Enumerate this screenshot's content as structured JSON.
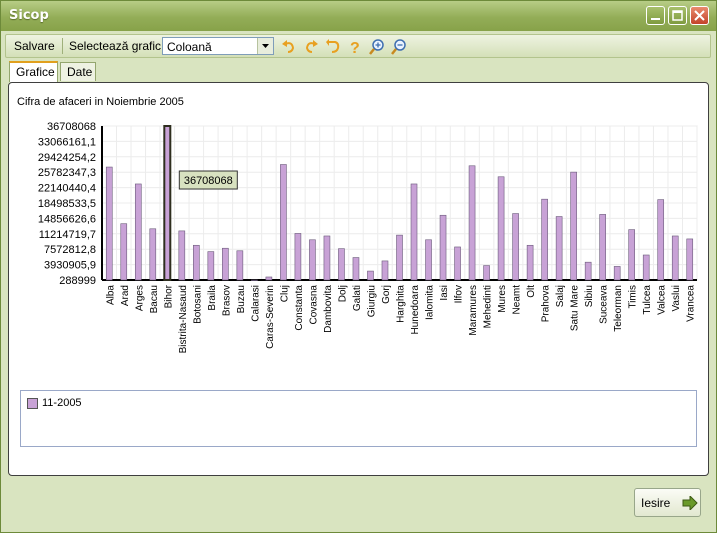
{
  "window": {
    "title": "Sicop"
  },
  "toolbar": {
    "save_label": "Salvare",
    "select_chart_label": "Selectează grafic",
    "chart_type_value": "Coloană",
    "icons": [
      "undo-icon",
      "redo-icon",
      "refresh-icon",
      "help-icon",
      "zoom-in-icon",
      "zoom-out-icon"
    ]
  },
  "tabs": [
    {
      "label": "Grafice",
      "active": true
    },
    {
      "label": "Date",
      "active": false
    }
  ],
  "tooltip": {
    "text": "36708068"
  },
  "legend": {
    "label": "11-2005"
  },
  "exit_label": "Iesire",
  "colors": {
    "bar": "#c8a2d6",
    "bar_border": "#6a5a7a",
    "highlight": "#2e2e1e",
    "tooltip_bg": "#d8e2c0",
    "window": "#d9e4c0",
    "title_bar": "#93ad57"
  },
  "chart_data": {
    "type": "bar",
    "title": "Cifra de afaceri in Noiembrie 2005",
    "ylim": [
      288999,
      36708068
    ],
    "yticks": [
      "36708068",
      "33066161,1",
      "29424254,2",
      "25782347,3",
      "22140440,4",
      "18498533,5",
      "14856626,6",
      "11214719,7",
      "7572812,8",
      "3930905,9",
      "288999"
    ],
    "grid": true,
    "legend_placement": "bottom",
    "highlighted_category": "Bihor",
    "categories": [
      "Alba",
      "Arad",
      "Arges",
      "Bacau",
      "Bihor",
      "Bistrita-Nasaud",
      "Botosani",
      "Braila",
      "Brasov",
      "Buzau",
      "Calarasi",
      "Caras-Severin",
      "Cluj",
      "Constanta",
      "Covasna",
      "Dambovita",
      "Dolj",
      "Galati",
      "Giurgiu",
      "Gorj",
      "Harghita",
      "Hunedoara",
      "Ialomita",
      "Iasi",
      "Ilfov",
      "Maramures",
      "Mehedinti",
      "Mures",
      "Neamt",
      "Olt",
      "Prahova",
      "Salaj",
      "Satu Mare",
      "Sibiu",
      "Suceava",
      "Teleorman",
      "Timis",
      "Tulcea",
      "Valcea",
      "Vaslui",
      "Vrancea"
    ],
    "series": [
      {
        "name": "11-2005",
        "values": [
          27000000,
          13600000,
          23000000,
          12400000,
          36708068,
          11900000,
          8500000,
          7000000,
          7800000,
          7200000,
          288999,
          1000000,
          27600000,
          11300000,
          9800000,
          10700000,
          7700000,
          5600000,
          2400000,
          4800000,
          10900000,
          23000000,
          9800000,
          15600000,
          8100000,
          27300000,
          3700000,
          24700000,
          16000000,
          8500000,
          19400000,
          15300000,
          25800000,
          4500000,
          15800000,
          3500000,
          12200000,
          6200000,
          19300000,
          10700000,
          10000000
        ]
      }
    ]
  }
}
